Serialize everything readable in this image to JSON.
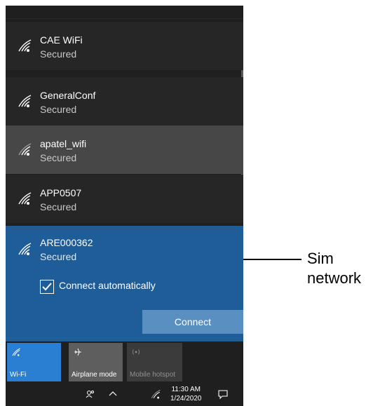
{
  "networks": [
    {
      "name": "CAE WiFi",
      "status": "Secured"
    },
    {
      "name": "GeneralConf",
      "status": "Secured"
    },
    {
      "name": "apatel_wifi",
      "status": "Secured"
    },
    {
      "name": "APP0507",
      "status": "Secured"
    }
  ],
  "selected_network": {
    "name": "ARE000362",
    "status": "Secured",
    "connect_automatically_label": "Connect automatically",
    "connect_automatically_checked": true,
    "connect_label": "Connect"
  },
  "quick_actions": [
    {
      "label": "Wi-Fi",
      "icon": "wifi-icon",
      "state": "on"
    },
    {
      "label": "Airplane mode",
      "icon": "airplane-icon",
      "state": "off"
    },
    {
      "label": "Mobile hotspot",
      "icon": "hotspot-icon",
      "state": "disabled"
    }
  ],
  "taskbar": {
    "time": "11:30 AM",
    "date": "1/24/2020",
    "icons": [
      "people-icon",
      "chevron-up-icon",
      "wifi-icon",
      "notification-icon"
    ]
  },
  "annotation": {
    "text_line1": "Sim",
    "text_line2": "network"
  },
  "colors": {
    "flyout_bg": "#1f1f1f",
    "selected_bg": "#1f5d98",
    "wifi_tile_on": "#2b7fd3",
    "tile_off": "#5e5e5e",
    "tile_disabled": "#3b3b3b"
  }
}
